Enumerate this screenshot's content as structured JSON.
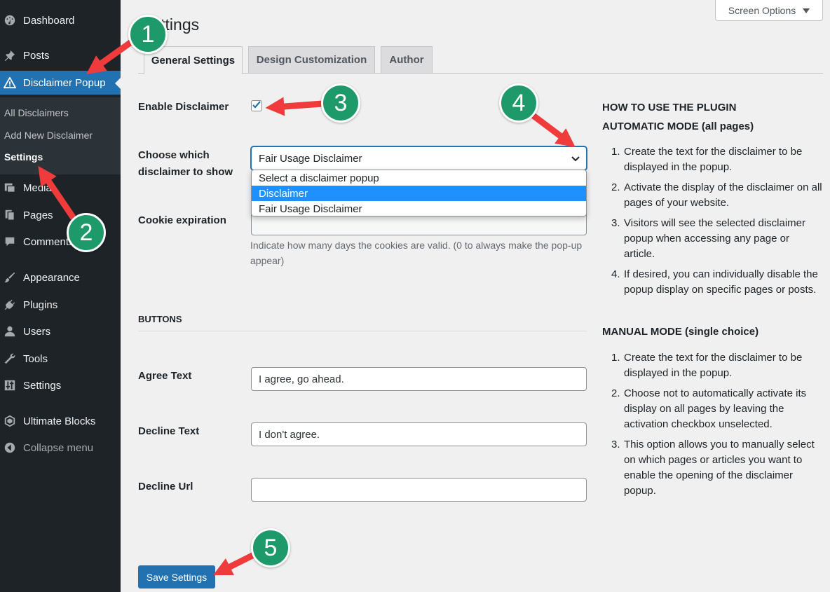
{
  "sidebar": {
    "items": [
      {
        "label": "Dashboard",
        "icon": "dashboard-icon"
      },
      {
        "label": "Posts",
        "icon": "pin-icon"
      },
      {
        "label": "Disclaimer Popup",
        "icon": "warning-icon"
      },
      {
        "label": "Media",
        "icon": "media-icon"
      },
      {
        "label": "Pages",
        "icon": "pages-icon"
      },
      {
        "label": "Comments",
        "icon": "comment-icon"
      },
      {
        "label": "Appearance",
        "icon": "brush-icon"
      },
      {
        "label": "Plugins",
        "icon": "plug-icon"
      },
      {
        "label": "Users",
        "icon": "user-icon"
      },
      {
        "label": "Tools",
        "icon": "wrench-icon"
      },
      {
        "label": "Settings",
        "icon": "sliders-icon"
      },
      {
        "label": "Ultimate Blocks",
        "icon": "blocks-icon"
      },
      {
        "label": "Collapse menu",
        "icon": "collapse-icon"
      }
    ],
    "submenu": [
      "All Disclaimers",
      "Add New Disclaimer",
      "Settings"
    ]
  },
  "header": {
    "screen_options": "Screen Options",
    "title": "Settings"
  },
  "tabs": [
    "General Settings",
    "Design Customization",
    "Author"
  ],
  "form": {
    "enable_label": "Enable Disclaimer",
    "enable_checked": true,
    "choose_label": "Choose which disclaimer to show",
    "choose_value": "Fair Usage Disclaimer",
    "choose_options": [
      "Select a disclaimer popup",
      "Disclaimer",
      "Fair Usage Disclaimer"
    ],
    "highlighted_option": "Disclaimer",
    "cookie_label": "Cookie expiration",
    "cookie_value": "",
    "cookie_desc": "Indicate how many days the cookies are valid. (0 to always make the pop-up appear)",
    "buttons_heading": "BUTTONS",
    "agree_label": "Agree Text",
    "agree_value": "I agree, go ahead.",
    "decline_label": "Decline Text",
    "decline_value": "I don't agree.",
    "decline_url_label": "Decline Url",
    "decline_url_value": "",
    "save_label": "Save Settings"
  },
  "help": {
    "heading": "HOW TO USE THE PLUGIN",
    "auto_heading": "AUTOMATIC MODE (all pages)",
    "auto_steps": [
      "Create the text for the disclaimer to be displayed in the popup.",
      "Activate the display of the disclaimer on all pages of your website.",
      "Visitors will see the selected disclaimer popup when accessing any page or article.",
      "If desired, you can individually disable the popup display on specific pages or posts."
    ],
    "manual_heading": "MANUAL MODE (single choice)",
    "manual_steps": [
      "Create the text for the disclaimer to be displayed in the popup.",
      "Choose not to automatically activate its display on all pages by leaving the activation checkbox unselected.",
      "This option allows you to manually select on which pages or articles you want to enable the opening of the disclaimer popup."
    ]
  },
  "annotations": [
    "1",
    "2",
    "3",
    "4",
    "5"
  ],
  "colors": {
    "sidebar_bg": "#1d2327",
    "accent": "#2271b1",
    "badge": "#1e9a6a",
    "arrow": "#ef3b3b",
    "dropdown_highlight": "#1e90ff"
  }
}
